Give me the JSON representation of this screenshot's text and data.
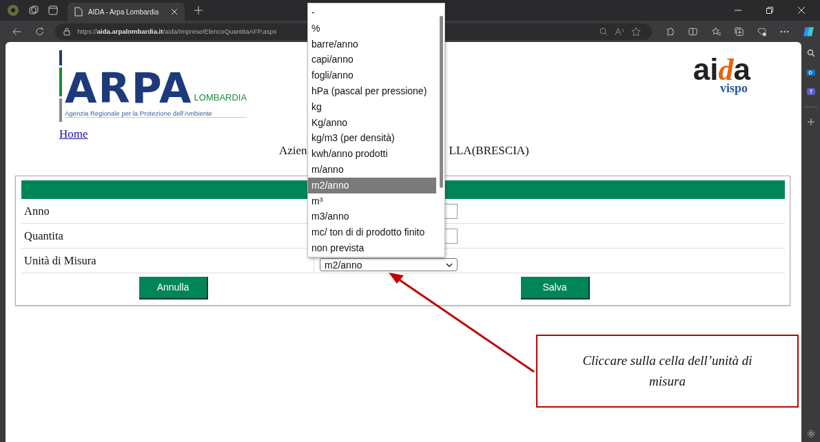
{
  "browser": {
    "tab_title": "AIDA - Arpa Lombardia",
    "url": "https://**aida.arpalombardia.it**/aida/Imprese/ElencoQuantitaAFP.aspx"
  },
  "header": {
    "arpa_logo": {
      "mark": "ARPA",
      "region": "LOMBARDIA",
      "tagline": "Agenzia Regionale per la Protezione dell’Ambiente"
    },
    "aida_logo": {
      "word_start": "ai",
      "word_mid": "d",
      "word_end": "a",
      "sub": "vispo"
    },
    "home_link": "Home",
    "title_left": "Azien",
    "title_right": "LLA(BRESCIA)"
  },
  "form": {
    "rows": [
      {
        "label": "Anno",
        "kind": "input"
      },
      {
        "label": "Quantita",
        "kind": "input"
      },
      {
        "label": "Unità di Misura",
        "kind": "select",
        "value": "m2/anno"
      }
    ],
    "buttons": [
      "Annulla",
      "Salva"
    ]
  },
  "dropdown": {
    "options": [
      {
        "label": "-",
        "selected": false
      },
      {
        "label": "%",
        "selected": false
      },
      {
        "label": "barre/anno",
        "selected": false
      },
      {
        "label": "capi/anno",
        "selected": false
      },
      {
        "label": "fogli/anno",
        "selected": false
      },
      {
        "label": "hPa (pascal per pressione)",
        "selected": false
      },
      {
        "label": "kg",
        "selected": false
      },
      {
        "label": "Kg/anno",
        "selected": false
      },
      {
        "label": "kg/m3 (per densità)",
        "selected": false
      },
      {
        "label": "kwh/anno prodotti",
        "selected": false
      },
      {
        "label": "m/anno",
        "selected": false
      },
      {
        "label": "m2/anno",
        "selected": true
      },
      {
        "label": "m³",
        "selected": false
      },
      {
        "label": "m3/anno",
        "selected": false
      },
      {
        "label": "mc/ ton di di prodotto finito",
        "selected": false
      },
      {
        "label": "non prevista",
        "selected": false
      }
    ]
  },
  "callout": "Cliccare sulla cella dell’unità di misura"
}
